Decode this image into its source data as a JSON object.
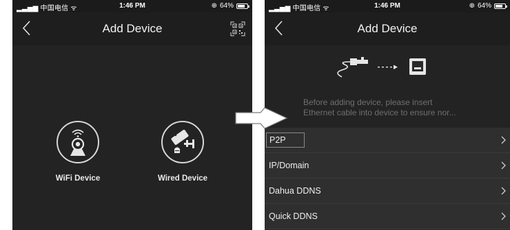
{
  "left_screen": {
    "status": {
      "carrier": "中国电信",
      "time": "1:46 PM",
      "battery": "64%"
    },
    "nav": {
      "title": "Add Device"
    },
    "devices": [
      {
        "label": "WiFi Device",
        "icon": "wifi-camera-icon"
      },
      {
        "label": "Wired Device",
        "icon": "wired-camera-icon"
      }
    ]
  },
  "right_screen": {
    "status": {
      "carrier": "中国电信",
      "time": "1:46 PM",
      "battery": "64%"
    },
    "nav": {
      "title": "Add Device"
    },
    "hint_line1": "Before adding device, please insert",
    "hint_line2": "Ethernet cable into device to ensure nor...",
    "menu": [
      {
        "label": "P2P"
      },
      {
        "label": "IP/Domain"
      },
      {
        "label": "Dahua DDNS"
      },
      {
        "label": "Quick DDNS"
      }
    ]
  },
  "colors": {
    "screen_bg": "#232323",
    "nav_bg": "#1e1e1e",
    "menu_bg": "#2f2f2f",
    "hint_text": "#6f6f6f"
  }
}
